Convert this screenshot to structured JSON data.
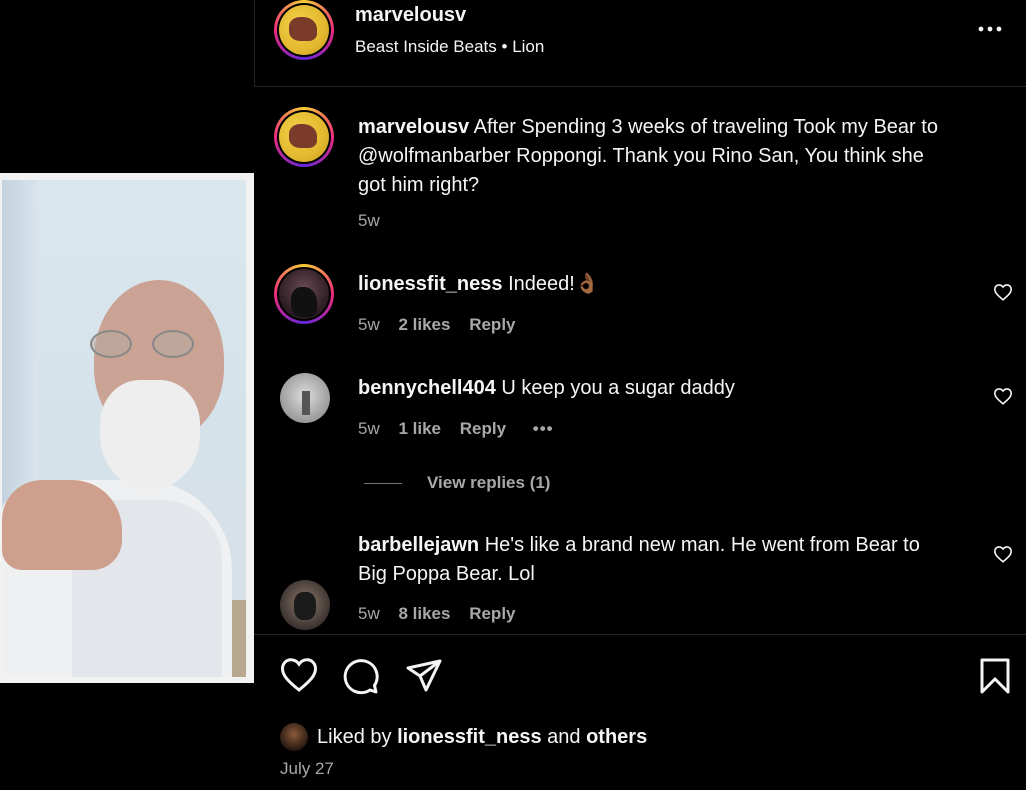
{
  "header": {
    "username": "marvelousv",
    "audio": "Beast Inside Beats",
    "dot": "•",
    "location": "Lion"
  },
  "caption": {
    "username": "marvelousv",
    "text_part1": "After Spending 3 weeks of traveling Took my Bear to",
    "mention": "@wolfmanbarber",
    "text_part2": "Roppongi. Thank you Rino San, You think she",
    "text_part3": "got him right?",
    "time": "5w"
  },
  "comments": [
    {
      "username": "lionessfit_ness",
      "text": "Indeed!👌🏾",
      "time": "5w",
      "likes": "2 likes",
      "reply": "Reply"
    },
    {
      "username": "bennychell404",
      "text": "U keep you a sugar daddy",
      "time": "5w",
      "likes": "1 like",
      "reply": "Reply",
      "more": "•••",
      "view_replies": "View replies (1)"
    },
    {
      "username": "barbellejawn",
      "text_line1": "He's like a brand new man. He went from Bear to",
      "text_line2": "Big Poppa Bear. Lol",
      "time": "5w",
      "likes": "8 likes",
      "reply": "Reply"
    }
  ],
  "footer": {
    "liked_by_prefix": "Liked by",
    "liked_by_user": "lionessfit_ness",
    "liked_by_and": "and",
    "liked_by_others": "others",
    "date": "July 27"
  },
  "icons": {
    "more": "more-options-icon",
    "like": "heart-icon",
    "comment": "comment-icon",
    "share": "share-icon",
    "save": "bookmark-icon"
  }
}
